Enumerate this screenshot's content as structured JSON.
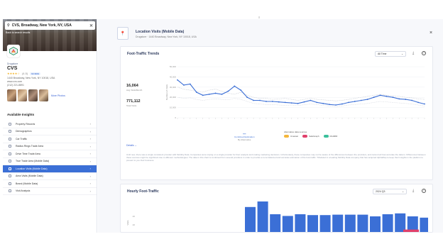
{
  "top_marker": "≡",
  "sidebar": {
    "search": {
      "value": "CVS, Broadway, New York, NY, USA",
      "back_link": "Back to search results"
    },
    "category": "Drugstore",
    "name": "CVS",
    "rating": {
      "stars": "★★★★☆",
      "count": "(4.5)",
      "tag": "$$ $$$$"
    },
    "address_lines": [
      "1440 Broadway, New York, NY 10018, USA",
      "www.cvs.com",
      "(212) 221-8891"
    ],
    "more_photos": "More Photos",
    "available_insights_title": "Available Insights",
    "insights": [
      {
        "label": "Property Records"
      },
      {
        "label": "Demographics"
      },
      {
        "label": "Car Traffic"
      },
      {
        "label": "Radius Rings Trade Area"
      },
      {
        "label": "Drive Time Trade Area"
      },
      {
        "label": "True Trade Area (Mobile Data)"
      },
      {
        "label": "Location Visits (Mobile Data)"
      },
      {
        "label": "Area Visits (Mobile Data)"
      },
      {
        "label": "Brand (Mobile Data)"
      },
      {
        "label": "Visit Analysis"
      }
    ]
  },
  "header": {
    "title": "Location Visits (Mobile Data)",
    "subtitle": "Drugstore · 1440 Broadway, New York, NY 10018, USA",
    "close": "×"
  },
  "foot_traffic": {
    "title": "Foot-Traffic Trends",
    "period": "All Time",
    "stat1_value": "16,064",
    "stat1_label": "Avg Visits/Month",
    "stat2_value": "771,112",
    "stat2_label": "Total Visits",
    "y_label": "Number of Visits",
    "legend_left_title": "Combined Estimation",
    "legend_left_sub": "By Alternative",
    "legend_right_title": "Alternative data sources",
    "sources": [
      {
        "name": "Unacast",
        "color": "#f4b63b"
      },
      {
        "name": "SafeGraph",
        "color": "#e0406b"
      },
      {
        "name": "MobiBill",
        "color": "#3bbf9b"
      }
    ],
    "details": "Details",
    "disclaimer": "Until now, there was a single consistent provider with Mobility Data. Companies were relying on a single provider for their analysis and making marketing decisions. Unfortunately, these companies may not be aware of the differences between the providers, and cannot tell how accurate the data is. Differences between these sources might be significant due to different methodologies. The data in this chart is combined from several providers in order to provide a more balanced and accurate estimation of the foot-traffic. *Modeled in a leading Mobility Data company that has acquired AlphaMap to keep their insights in the platform to present to you their business."
  },
  "hourly": {
    "title": "Hourly Foot-Traffic",
    "period": "2024 Q3",
    "y_label": "Visits"
  },
  "chart_data": [
    {
      "type": "line",
      "title": "Foot-Traffic Trends",
      "ylabel": "Number of Visits",
      "ylim": [
        0,
        50000
      ],
      "y_ticks": [
        0,
        10000,
        20000,
        30000,
        40000,
        50000
      ],
      "x_count": 40,
      "series": [
        {
          "name": "Combined Estimation",
          "color": "#3b6fd6",
          "values": [
            37000,
            32000,
            33000,
            25000,
            22000,
            23000,
            24000,
            23000,
            26000,
            31000,
            27000,
            20000,
            17000,
            17000,
            16000,
            16000,
            15500,
            15000,
            14500,
            14000,
            15500,
            17000,
            15000,
            14000,
            13000,
            12500,
            13500,
            15000,
            16000,
            17000,
            18000,
            20000,
            22000,
            21000,
            20000,
            18500,
            18000,
            17000,
            15000,
            13500
          ]
        },
        {
          "name": "Unacast",
          "color": "#c9cdd6",
          "values": [
            30000,
            28000,
            27000,
            26000,
            25000,
            27000,
            28000,
            26000,
            24000,
            23000,
            25000,
            22000,
            20000,
            19000,
            19000,
            18000,
            18500,
            19000,
            18000,
            17000,
            18000,
            19000,
            18000,
            17500,
            17000,
            16500,
            17000,
            18000,
            19000,
            20000,
            21000,
            22000,
            23000,
            22000,
            21500,
            21000,
            20000,
            19500,
            18500,
            18000
          ]
        },
        {
          "name": "SafeGraph",
          "color": "#d8dbe2",
          "values": [
            20000,
            19000,
            19500,
            18000,
            17000,
            18000,
            18500,
            18000,
            17500,
            19000,
            18000,
            16000,
            14000,
            13500,
            13000,
            13000,
            12500,
            12000,
            12500,
            12000,
            12800,
            13500,
            13000,
            12000,
            11500,
            11000,
            11500,
            12500,
            13000,
            13500,
            14000,
            15000,
            16000,
            15500,
            15000,
            14500,
            14000,
            13500,
            12500,
            11500
          ]
        }
      ]
    },
    {
      "type": "bar",
      "title": "Hourly Foot-Traffic",
      "ylabel": "Visits",
      "ylim": [
        0,
        100
      ],
      "values": [
        62,
        79,
        45,
        41,
        45,
        43,
        43,
        44,
        44,
        44,
        40,
        45,
        47,
        40,
        37
      ],
      "highlight_value": 9
    }
  ]
}
